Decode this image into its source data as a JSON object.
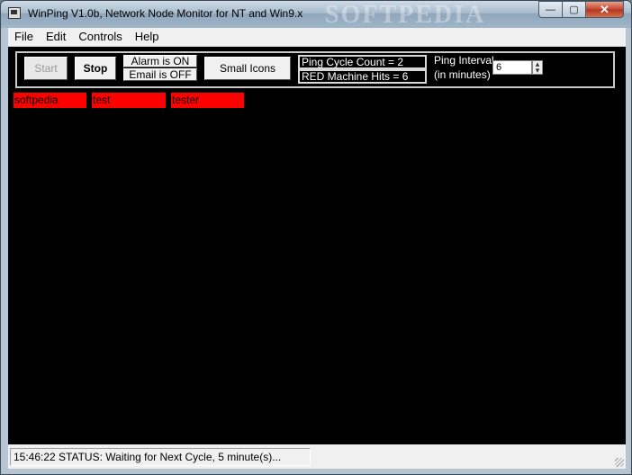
{
  "window": {
    "title": "WinPing V1.0b, Network Node Monitor for NT and Win9.x",
    "watermark": "SOFTPEDIA",
    "minimize_glyph": "—",
    "maximize_glyph": "▢",
    "close_glyph": "✕"
  },
  "menu": {
    "items": [
      "File",
      "Edit",
      "Controls",
      "Help"
    ]
  },
  "toolbar": {
    "start_label": "Start",
    "stop_label": "Stop",
    "alarm_label": "Alarm is ON",
    "email_label": "Email is OFF",
    "icons_label": "Small Icons",
    "ping_cycle_count": "Ping Cycle Count = 2",
    "red_machine_hits": "RED Machine Hits = 6",
    "ping_interval_label": "Ping Interval",
    "ping_interval_sub": "(in minutes)",
    "ping_interval_value": "6"
  },
  "nodes": [
    {
      "name": "softpedia",
      "status_color": "#ff0000"
    },
    {
      "name": "test",
      "status_color": "#ff0000"
    },
    {
      "name": "tester",
      "status_color": "#ff0000"
    }
  ],
  "status": {
    "text": "15:46:22 STATUS:  Waiting for Next Cycle,  5 minute(s)..."
  }
}
